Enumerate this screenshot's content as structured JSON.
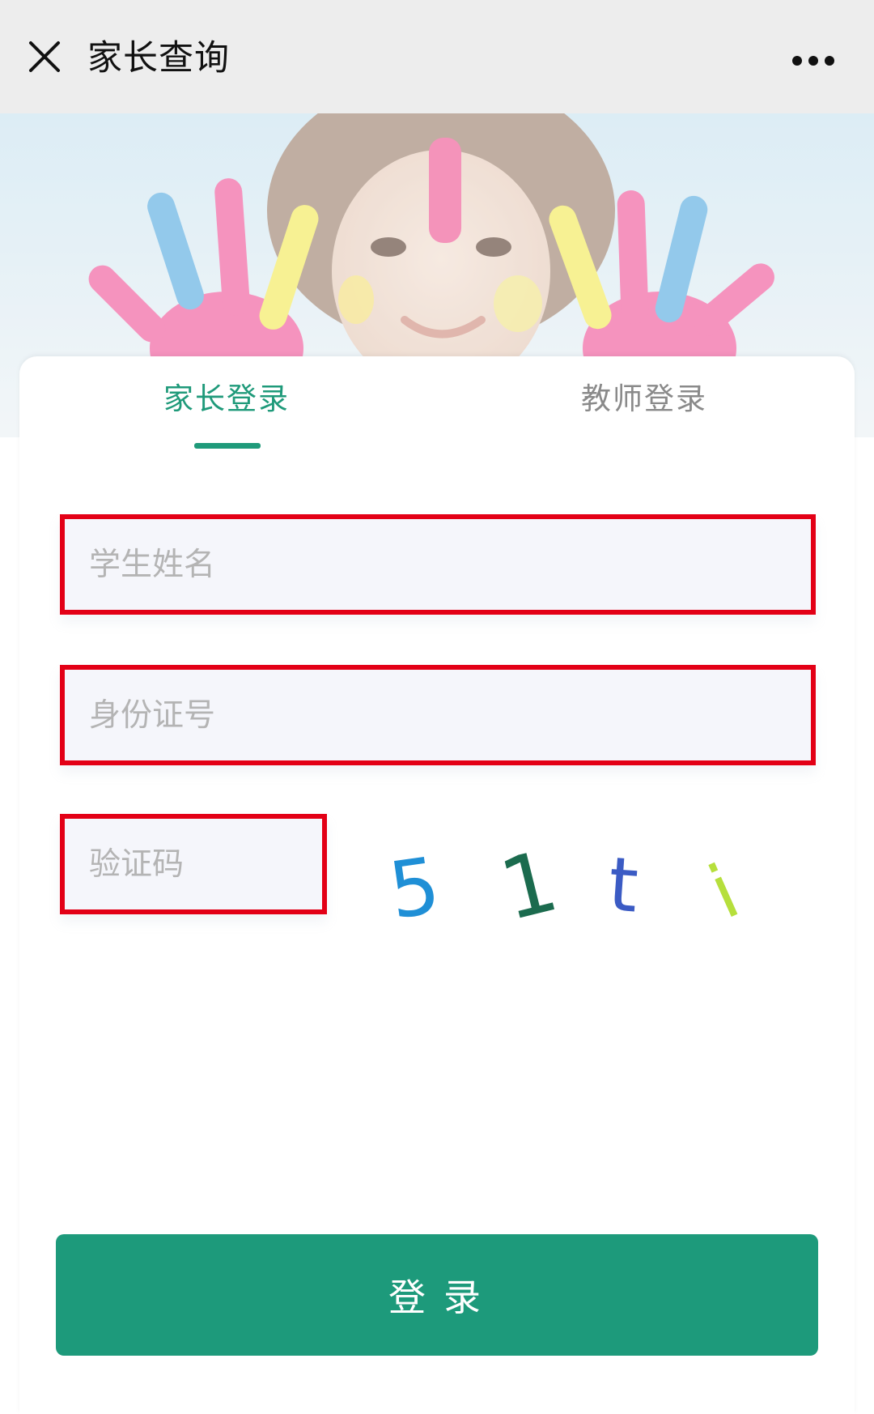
{
  "header": {
    "title": "家长查询",
    "close_icon": "close-icon",
    "more_icon": "more-dots-icon"
  },
  "tabs": {
    "parent_label": "家长登录",
    "teacher_label": "教师登录",
    "active": "parent"
  },
  "form": {
    "student_name_placeholder": "学生姓名",
    "student_name_value": "",
    "id_number_placeholder": "身份证号",
    "id_number_value": "",
    "captcha_placeholder": "验证码",
    "captcha_value": "",
    "captcha_chars": [
      "5",
      "1",
      "t",
      "i"
    ],
    "captcha_colors": [
      "#1f8fd6",
      "#1b6b4e",
      "#3b5bc4",
      "#b6df3c"
    ]
  },
  "login_button_label": "登录",
  "colors": {
    "accent": "#1f9a7a",
    "highlight_border": "#e30016",
    "topbar_bg": "#ededed"
  }
}
